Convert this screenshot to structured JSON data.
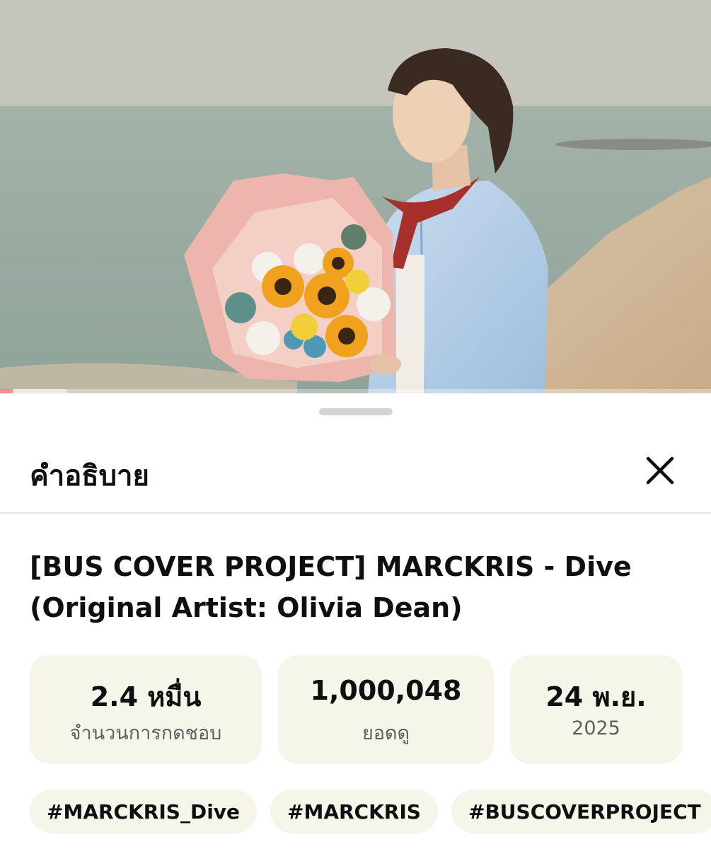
{
  "video": {
    "progress_fraction": 0.018,
    "buffer_fraction": 0.095,
    "progress_color": "#ff0000"
  },
  "sheet": {
    "title": "คำอธิบาย",
    "close_icon": "close-icon"
  },
  "description": {
    "title_line1": "[BUS COVER PROJECT] MARCKRIS - Dive",
    "title_line2": "(Original Artist: Olivia Dean)",
    "stats": [
      {
        "value": "2.4 หมื่น",
        "label": "จำนวนการกดชอบ"
      },
      {
        "value": "1,000,048",
        "label": "ยอดดู"
      },
      {
        "value": "24 พ.ย.",
        "label": "2025"
      }
    ],
    "hashtags": [
      "#MARCKRIS_Dive",
      "#MARCKRIS",
      "#BUSCOVERPROJECT"
    ]
  },
  "colors": {
    "chip_background": "#f5f5e9",
    "secondary_text": "#606060"
  }
}
